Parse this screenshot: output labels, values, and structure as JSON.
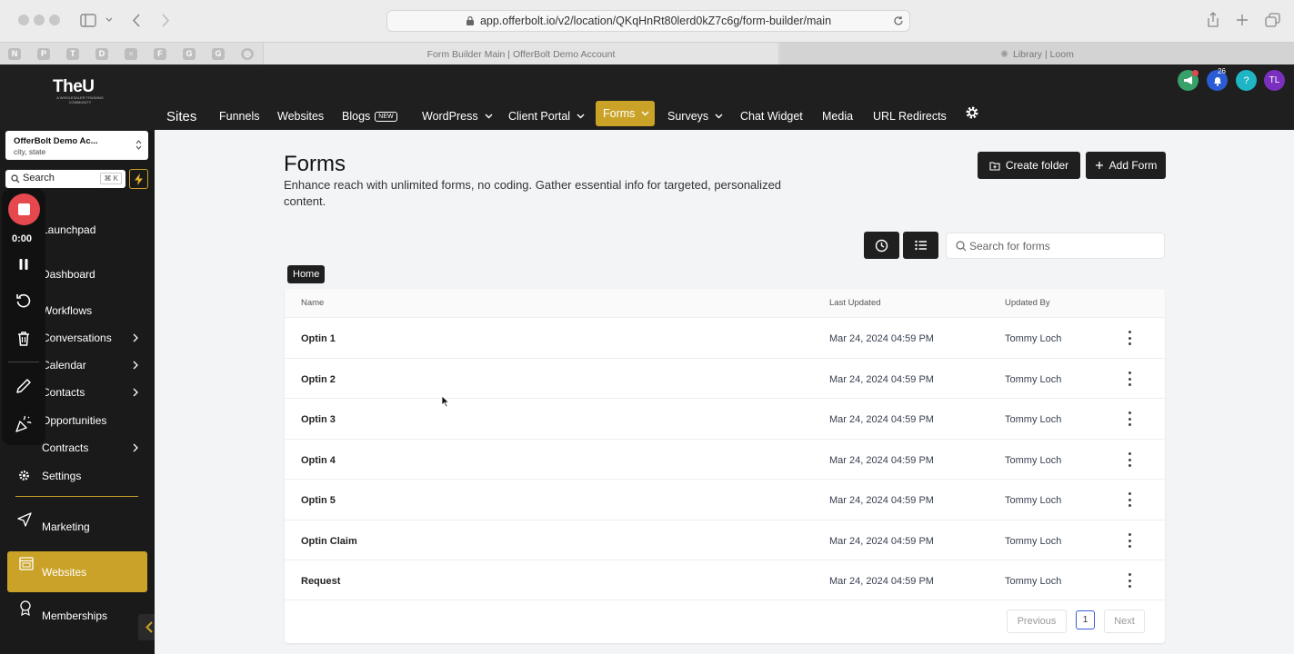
{
  "browser": {
    "url": "app.offerbolt.io/v2/location/QKqHnRt80lerd0kZ7c6g/form-builder/main",
    "favicons": [
      "N",
      "P",
      "T",
      "D",
      "♅",
      "F",
      "G",
      "G",
      "◎"
    ],
    "tabs": [
      {
        "label": "Form Builder Main | OfferBolt Demo Account",
        "active": true
      },
      {
        "label": "Library | Loom",
        "active": false
      }
    ]
  },
  "topbar": {
    "logo_text": "TheU",
    "logo_sub": "A WHOLESALER TRAINING COMMUNITY",
    "section_title": "Sites",
    "nav": [
      {
        "label": "Funnels"
      },
      {
        "label": "Websites"
      },
      {
        "label": "Blogs",
        "badge": "NEW"
      },
      {
        "label": "WordPress",
        "dropdown": true
      },
      {
        "label": "Client Portal",
        "dropdown": true
      },
      {
        "label": "Forms",
        "dropdown": true,
        "active": true
      },
      {
        "label": "Surveys",
        "dropdown": true
      },
      {
        "label": "Chat Widget"
      },
      {
        "label": "Media"
      },
      {
        "label": "URL Redirects"
      }
    ],
    "notification_count": "26",
    "avatar_initials": "TL",
    "help_label": "?"
  },
  "sidebar": {
    "account_name": "OfferBolt Demo Ac...",
    "account_location": "city, state",
    "search_placeholder": "Search",
    "search_shortcut": "⌘ K",
    "items": [
      {
        "label": "Launchpad"
      },
      {
        "label": "Dashboard"
      },
      {
        "label": "Workflows"
      },
      {
        "label": "Conversations",
        "chevron": true
      },
      {
        "label": "Calendar",
        "chevron": true
      },
      {
        "label": "Contacts",
        "chevron": true
      },
      {
        "label": "Opportunities"
      },
      {
        "label": "Contracts",
        "chevron": true
      },
      {
        "label": "Settings"
      },
      {
        "label": "Marketing"
      },
      {
        "label": "Websites",
        "active": true
      },
      {
        "label": "Memberships"
      }
    ]
  },
  "recorder": {
    "timer": "0:00"
  },
  "page": {
    "title": "Forms",
    "description": "Enhance reach with unlimited forms, no coding. Gather essential info for targeted, personalized content.",
    "create_folder_label": "Create folder",
    "add_form_label": "Add Form",
    "search_placeholder": "Search for forms",
    "breadcrumb": "Home"
  },
  "table": {
    "columns": [
      "Name",
      "Last Updated",
      "Updated By"
    ],
    "rows": [
      {
        "name": "Optin 1",
        "updated": "Mar 24, 2024 04:59 PM",
        "by": "Tommy Loch"
      },
      {
        "name": "Optin 2",
        "updated": "Mar 24, 2024 04:59 PM",
        "by": "Tommy Loch"
      },
      {
        "name": "Optin 3",
        "updated": "Mar 24, 2024 04:59 PM",
        "by": "Tommy Loch"
      },
      {
        "name": "Optin 4",
        "updated": "Mar 24, 2024 04:59 PM",
        "by": "Tommy Loch"
      },
      {
        "name": "Optin 5",
        "updated": "Mar 24, 2024 04:59 PM",
        "by": "Tommy Loch"
      },
      {
        "name": "Optin Claim",
        "updated": "Mar 24, 2024 04:59 PM",
        "by": "Tommy Loch"
      },
      {
        "name": "Request",
        "updated": "Mar 24, 2024 04:59 PM",
        "by": "Tommy Loch"
      }
    ],
    "pagination": {
      "previous": "Previous",
      "page": "1",
      "next": "Next"
    }
  },
  "colors": {
    "accent": "#c9a227",
    "dark": "#1f1f1f",
    "record_red": "#e5484d"
  }
}
